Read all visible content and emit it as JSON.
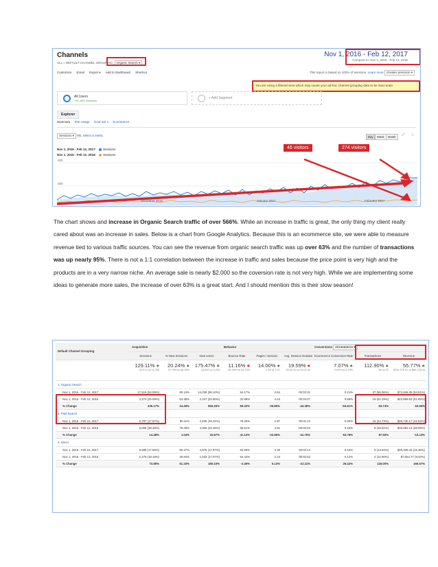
{
  "screenshot1": {
    "title": "Channels",
    "breadcrumb": "ALL » DEFAULT CHANNEL GROUPING:",
    "breadcrumb_value": "Organic Search",
    "toolbar": [
      "Customize",
      "Email",
      "Export ▾",
      "Add to Dashboard",
      "Shortcut"
    ],
    "date_range": "Nov 1, 2016 - Feb 12, 2017",
    "compare": "Compare to: Nov 1, 2015 - Feb 12, 2016",
    "report_note": "This report is based on 100% of sessions.",
    "learn_more": "Learn more",
    "precision": "Greater precision",
    "warning": "You are using a filtered view which may cause your ad-hoc channel grouping data to be inaccurate.",
    "segment_name": "All Users",
    "segment_sub": "+51.28% Sessions",
    "add_segment": "+ Add Segment",
    "explorer_tab": "Explorer",
    "subtabs": [
      "Summary",
      "Site Usage",
      "Goal Set 1",
      "Ecommerce"
    ],
    "metric_select": "Sessions",
    "vs": "VS.",
    "select_metric": "Select a metric",
    "legend": [
      {
        "range": "Nov 1, 2016 - Feb 12, 2017:",
        "metric": "Sessions",
        "color": "#2c7fd6"
      },
      {
        "range": "Nov 1, 2015 - Feb 12, 2016:",
        "metric": "Sessions",
        "color": "#f0a030"
      }
    ],
    "period_buttons": [
      "Day",
      "Week",
      "Month"
    ],
    "y_ticks": [
      "400",
      "200"
    ],
    "x_ticks": [
      "December 2016",
      "January 2017",
      "February 2017"
    ],
    "callout1": "46 visitors",
    "callout2": "274 visitors"
  },
  "paragraph": {
    "p1": "The chart shows and ",
    "b1": "increase in Organic Search traffic of over 566%",
    "p2": ".  While an increase in traffic is great, the only thing my client really cared about was an increase in sales.  Below is a chart from Google Analytics.  Because this is an ecommerce site, we were able to measure revenue tied to various traffic sources.  You can see the revenue from organic search traffic was up ",
    "b2": "over 63%",
    "p3": " and the number of ",
    "b3": "transactions was up nearly 95%",
    "p4": ".  There is not a 1:1 correlation between the increase in traffic and sales because the price point is very high and the products are in a very narrow niche.  An average sale is nearly $2,000 so the coversion rate is not very high.  While we are implementing some ideas to generate more sales, the increase of over 63% is a great start.  And I should mention this is their slow season!"
  },
  "table": {
    "col_group": "Default Channel Grouping",
    "acquisition": "Acquisition",
    "behavior": "Behavior",
    "conversions": "Conversions",
    "conv_select": "eCommerce ▾",
    "headers": [
      "Sessions",
      "% New Sessions",
      "New Users",
      "Bounce Rate",
      "Pages / Session",
      "Avg. Session Duration",
      "Ecommerce Conversion Rate",
      "Transactions",
      "Revenue"
    ],
    "totals": [
      {
        "v": "129.11%",
        "s": "20,374 vs 14,765"
      },
      {
        "v": "20.24%",
        "s": "79.79% vs 66.35%"
      },
      {
        "v": "175.47%",
        "s": "25,962 vs 9,425"
      },
      {
        "v": "11.16%",
        "s": "60.28% vs 54.23%"
      },
      {
        "v": "14.00%",
        "s": "2.55 vs 2.97"
      },
      {
        "v": "19.59%",
        "s": "00:02:10 vs 00:02:43"
      },
      {
        "v": "7.07%",
        "s": "0.20% vs 0.19%"
      },
      {
        "v": "112.90%",
        "s": "66 vs 31"
      },
      {
        "v": "55.77%",
        "s": "$131,975.41 vs $84,726.44"
      }
    ],
    "groups": [
      {
        "name": "1.  Organic Search",
        "rows": [
          {
            "label": "Nov 1, 2016 - Feb 12, 2017",
            "cells": [
              "17,516 (54.09%)",
              "80.14%",
              "14,038 (55.10%)",
              "54.17%",
              "2.84",
              "00:02:31",
              "0.21%",
              "37 (56.06%)",
              "$71,946.45 (54.51%)"
            ]
          },
          {
            "label": "Nov 1, 2015 - Feb 12, 2016",
            "cells": [
              "3,273 (25.09%)",
              "64.38%",
              "2,107 (22.80%)",
              "31.99%",
              "4.43",
              "00:04:27",
              "0.58%",
              "19 (61.29%)",
              "$43,989.53 (51.92%)"
            ]
          },
          {
            "label": "% Change",
            "cells": [
              "435.17%",
              "24.49%",
              "566.26%",
              "69.33%",
              "-35.85%",
              "-43.38%",
              "-63.61%",
              "94.74%",
              "63.55%"
            ]
          }
        ]
      },
      {
        "name": "2.  Paid Search",
        "rows": [
          {
            "label": "Nov 1, 2016 - Feb 12, 2017",
            "cells": [
              "5,787 (17.87%)",
              "80.11%",
              "4,636 (18.21%)",
              "78.35%",
              "1.87",
              "00:01:12",
              "0.26%",
              "15 (22.73%)",
              "$29,730.17 (22.53%)"
            ]
          },
          {
            "label": "Nov 1, 2015 - Feb 12, 2016",
            "cells": [
              "5,055 (38.48%)",
              "79.29%",
              "4,008 (43.36%)",
              "55.51%",
              "2.81",
              "00:02:04",
              "0.16%",
              "8 (25.81%)",
              "$33,082.14 (39.05%)"
            ]
          },
          {
            "label": "% Change",
            "cells": [
              "14.48%",
              "1.04%",
              "15.67%",
              "41.14%",
              "-33.56%",
              "-41.75%",
              "63.78%",
              "87.50%",
              "-10.13%"
            ]
          }
        ]
      },
      {
        "name": "3.  Direct",
        "rows": [
          {
            "label": "Nov 1, 2016 - Feb 12, 2017",
            "cells": [
              "5,685 (17.55%)",
              "80.47%",
              "4,575 (17.97%)",
              "62.95%",
              "2.36",
              "00:02:14",
              "0.16%",
              "9 (13.64%)",
              "$20,405.43 (15.46%)"
            ]
          },
          {
            "label": "Nov 1, 2015 - Feb 12, 2016",
            "cells": [
              "2,270 (18.18%)",
              "49.94%",
              "1,633 (17.67%)",
              "64.43%",
              "2.24",
              "00:02:52",
              "0.12%",
              "4 (12.90%)",
              "$7,654.77 (9.03%)"
            ]
          },
          {
            "label": "% Change",
            "cells": [
              "73.85%",
              "61.15%",
              "180.16%",
              "-2.46%",
              "6.13%",
              "-22.11%",
              "29.42%",
              "125.00%",
              "166.57%"
            ]
          }
        ]
      }
    ]
  }
}
